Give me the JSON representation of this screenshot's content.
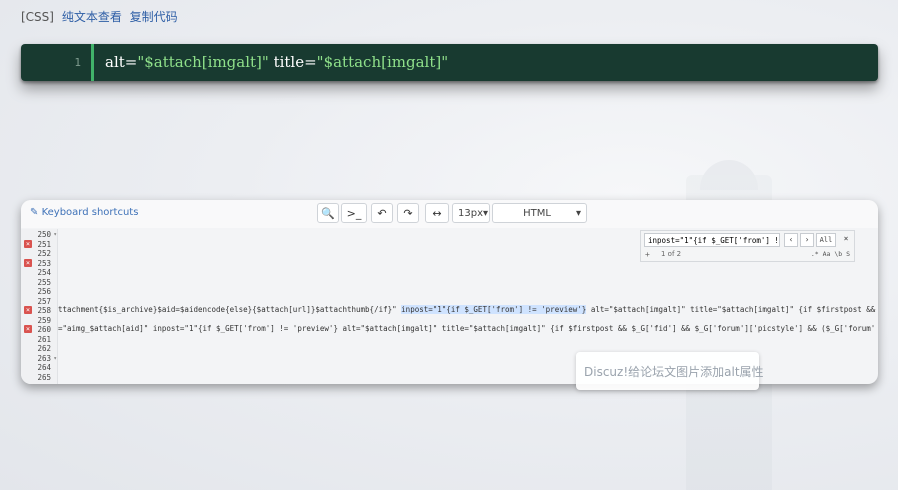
{
  "top_bar": {
    "tag": "[CSS]",
    "plain_text_link": "纯文本查看",
    "copy_code_link": "复制代码"
  },
  "code_block": {
    "line_number": "1",
    "attr1": "alt=",
    "value1": "\"$attach[imgalt]\"",
    "attr2": " title=",
    "value2": "\"$attach[imgalt]\""
  },
  "editor": {
    "keyboard_shortcuts": "Keyboard shortcuts",
    "font_size": "13px",
    "mode": "HTML",
    "gutter": [
      {
        "num": "250",
        "err": false,
        "fold": true
      },
      {
        "num": "251",
        "err": true,
        "fold": false
      },
      {
        "num": "252",
        "err": false,
        "fold": false
      },
      {
        "num": "253",
        "err": true,
        "fold": false
      },
      {
        "num": "254",
        "err": false,
        "fold": false
      },
      {
        "num": "255",
        "err": false,
        "fold": false
      },
      {
        "num": "256",
        "err": false,
        "fold": false
      },
      {
        "num": "257",
        "err": false,
        "fold": false
      },
      {
        "num": "258",
        "err": true,
        "fold": false
      },
      {
        "num": "259",
        "err": false,
        "fold": false
      },
      {
        "num": "260",
        "err": true,
        "fold": false
      },
      {
        "num": "261",
        "err": false,
        "fold": false
      },
      {
        "num": "262",
        "err": false,
        "fold": false
      },
      {
        "num": "263",
        "err": false,
        "fold": true
      },
      {
        "num": "264",
        "err": false,
        "fold": false
      },
      {
        "num": "265",
        "err": false,
        "fold": false
      }
    ],
    "line_258_a": "ttachment{$is_archive}$aid=$aidencode{else}{$attach[url]}$attachthumb{/if}\" ",
    "line_258_hl": "inpost=\"1\"{if $_GET['from'] != 'preview'}",
    "line_258_b": " alt=\"$attach[imgalt]\" title=\"$attach[imgalt]\" {if $firstpost &&",
    "line_260": "=\"aimg_$attach[aid]\" inpost=\"1\"{if $_GET['from'] != 'preview'} alt=\"$attach[imgalt]\" title=\"$attach[imgalt]\" {if $firstpost && $_G['fid'] && $_G['forum']['picstyle'] && ($_G['forum'",
    "search_query": "inpost=\"1\"{if $_GET['from'] !",
    "search_count": "1 of 2",
    "search_all": "All",
    "search_opts": ".* Aa \\b S"
  },
  "toast": {
    "text": "Discuz!给论坛文图片添加alt属性"
  }
}
